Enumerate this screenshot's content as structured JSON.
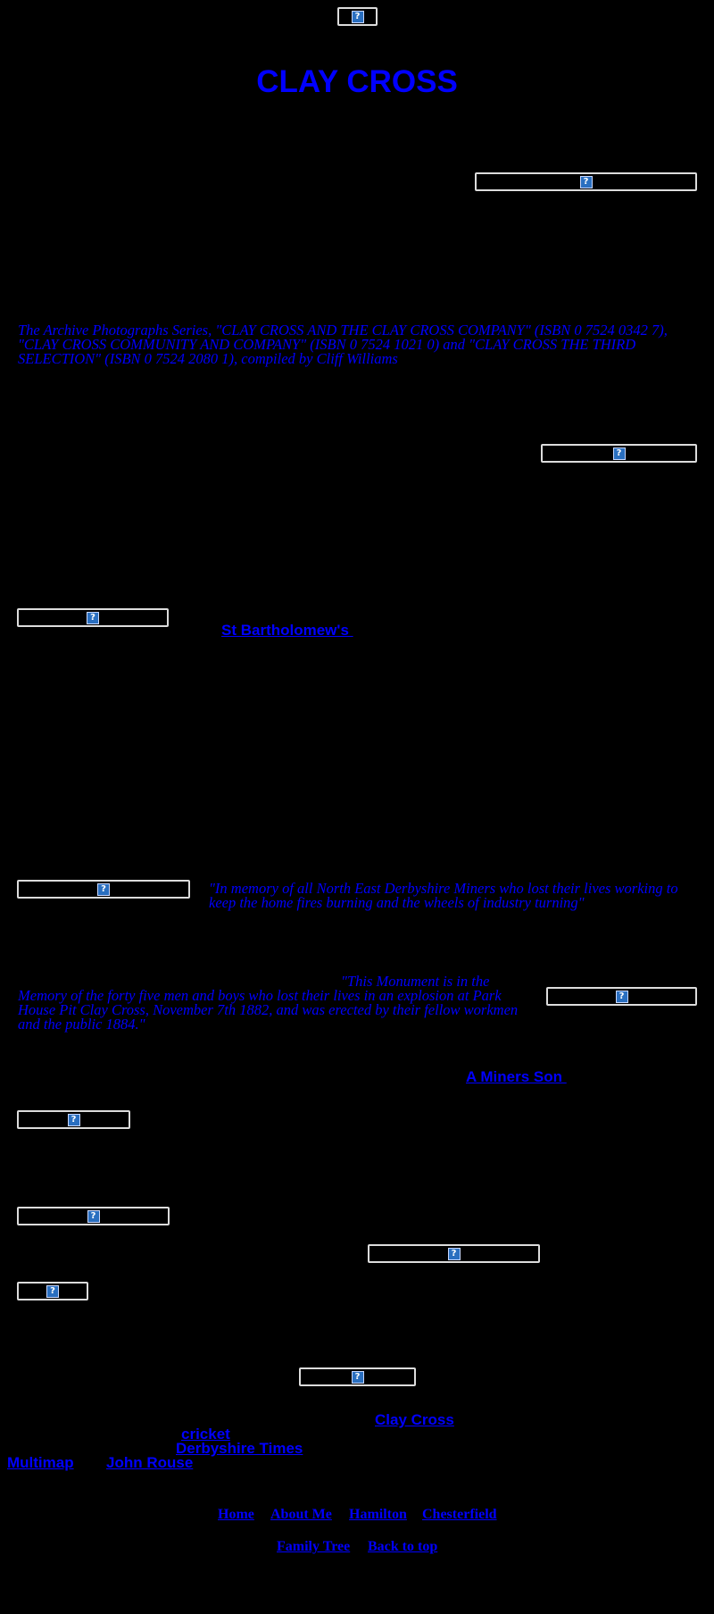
{
  "page": {
    "title": "CLAY CROSS",
    "images": {
      "top": "broken-image-icon",
      "img1": "broken-image-icon",
      "img2": "broken-image-icon",
      "img3": "broken-image-icon",
      "img4": "broken-image-icon",
      "img5": "broken-image-icon",
      "img6": "broken-image-icon",
      "img7": "broken-image-icon",
      "img8": "broken-image-icon",
      "img9": "broken-image-icon",
      "img10": "broken-image-icon"
    },
    "archive_credit": "The Archive Photographs Series, \"CLAY CROSS AND THE CLAY CROSS COMPANY\" (ISBN 0 7524 0342 7), \"CLAY CROSS COMMUNITY AND COMPANY\" (ISBN 0 7524 1021 0) and \"CLAY CROSS THE THIRD SELECTION\" (ISBN 0 7524 2080 1), compiled by Cliff Williams",
    "link_st_bartholomews": "St Bartholomew's ",
    "memorial_quote": "\"In memory of all North East Derbyshire Miners who lost their lives working to keep the home fires burning and the wheels of industry turning\"",
    "monument_quote_start": "\"This Monument is in the",
    "monument_quote_rest": "Memory of the forty five men and boys who lost their lives in an explosion at Park House Pit Clay Cross, November 7th 1882, and was erected by their fellow workmen and the public 1884.\"",
    "link_miners_son": "A Miners Son ",
    "links": {
      "clay_cross": "Clay Cross",
      "cricket": "cricket",
      "derbyshire_times": "Derbyshire Times",
      "multimap": "Multimap",
      "john_rouse": "John Rouse"
    },
    "footer_nav": [
      "Home",
      "About Me",
      "Hamilton",
      "Chesterfield"
    ],
    "footer_nav2": [
      "Family Tree",
      "Back to top"
    ],
    "broken_glyph": "?",
    "colors": {
      "background": "#000000",
      "text": "#0000ff",
      "border": "#dcdcdc"
    }
  }
}
